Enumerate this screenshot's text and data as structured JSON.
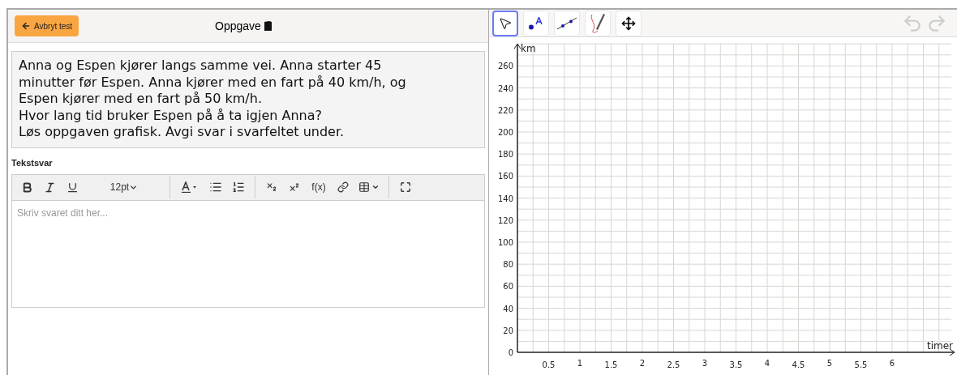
{
  "header": {
    "back_button": "Avbryt test",
    "title": "Oppgave"
  },
  "problem": {
    "paragraphs": [
      "Anna og Espen kjører langs samme vei. Anna starter 45 minutter før Espen. Anna kjører med en fart på 40 km/h, og Espen kjører med en fart på 50 km/h.",
      "Hvor lang tid bruker Espen på å ta igjen Anna?",
      "Løs oppgaven grafisk. Avgi svar i svarfeltet under."
    ]
  },
  "answer": {
    "label": "Tekstsvar",
    "placeholder": "Skriv svaret ditt her...",
    "toolbar": [
      {
        "kind": "bold"
      },
      {
        "kind": "italic"
      },
      {
        "kind": "underline"
      },
      {
        "kind": "size",
        "label": "12pt"
      },
      {
        "kind": "separator"
      },
      {
        "kind": "color"
      },
      {
        "kind": "bullets"
      },
      {
        "kind": "numbered"
      },
      {
        "kind": "separator"
      },
      {
        "kind": "subscript"
      },
      {
        "kind": "superscript"
      },
      {
        "kind": "formula",
        "label": "f(x)"
      },
      {
        "kind": "link"
      },
      {
        "kind": "table"
      },
      {
        "kind": "separator"
      },
      {
        "kind": "fullscreen"
      }
    ]
  },
  "graph": {
    "tools": [
      {
        "kind": "pointer",
        "selected": true
      },
      {
        "kind": "point",
        "selected": false
      },
      {
        "kind": "line",
        "selected": false
      },
      {
        "kind": "pen",
        "selected": false
      },
      {
        "kind": "move",
        "selected": false
      }
    ],
    "history": [
      {
        "kind": "undo",
        "disabled": true
      },
      {
        "kind": "redo",
        "disabled": true
      }
    ],
    "chart_data": {
      "type": "line",
      "grid": true,
      "xlabel": "timer",
      "ylabel": "km",
      "xlim": [
        0,
        7
      ],
      "ylim": [
        0,
        280
      ],
      "xticks": [
        0.5,
        1,
        1.5,
        2,
        2.5,
        3,
        3.5,
        4,
        4.5,
        5,
        5.5,
        6
      ],
      "yticks": [
        0,
        20,
        40,
        60,
        80,
        100,
        120,
        140,
        160,
        180,
        200,
        220,
        240,
        260
      ]
    }
  }
}
